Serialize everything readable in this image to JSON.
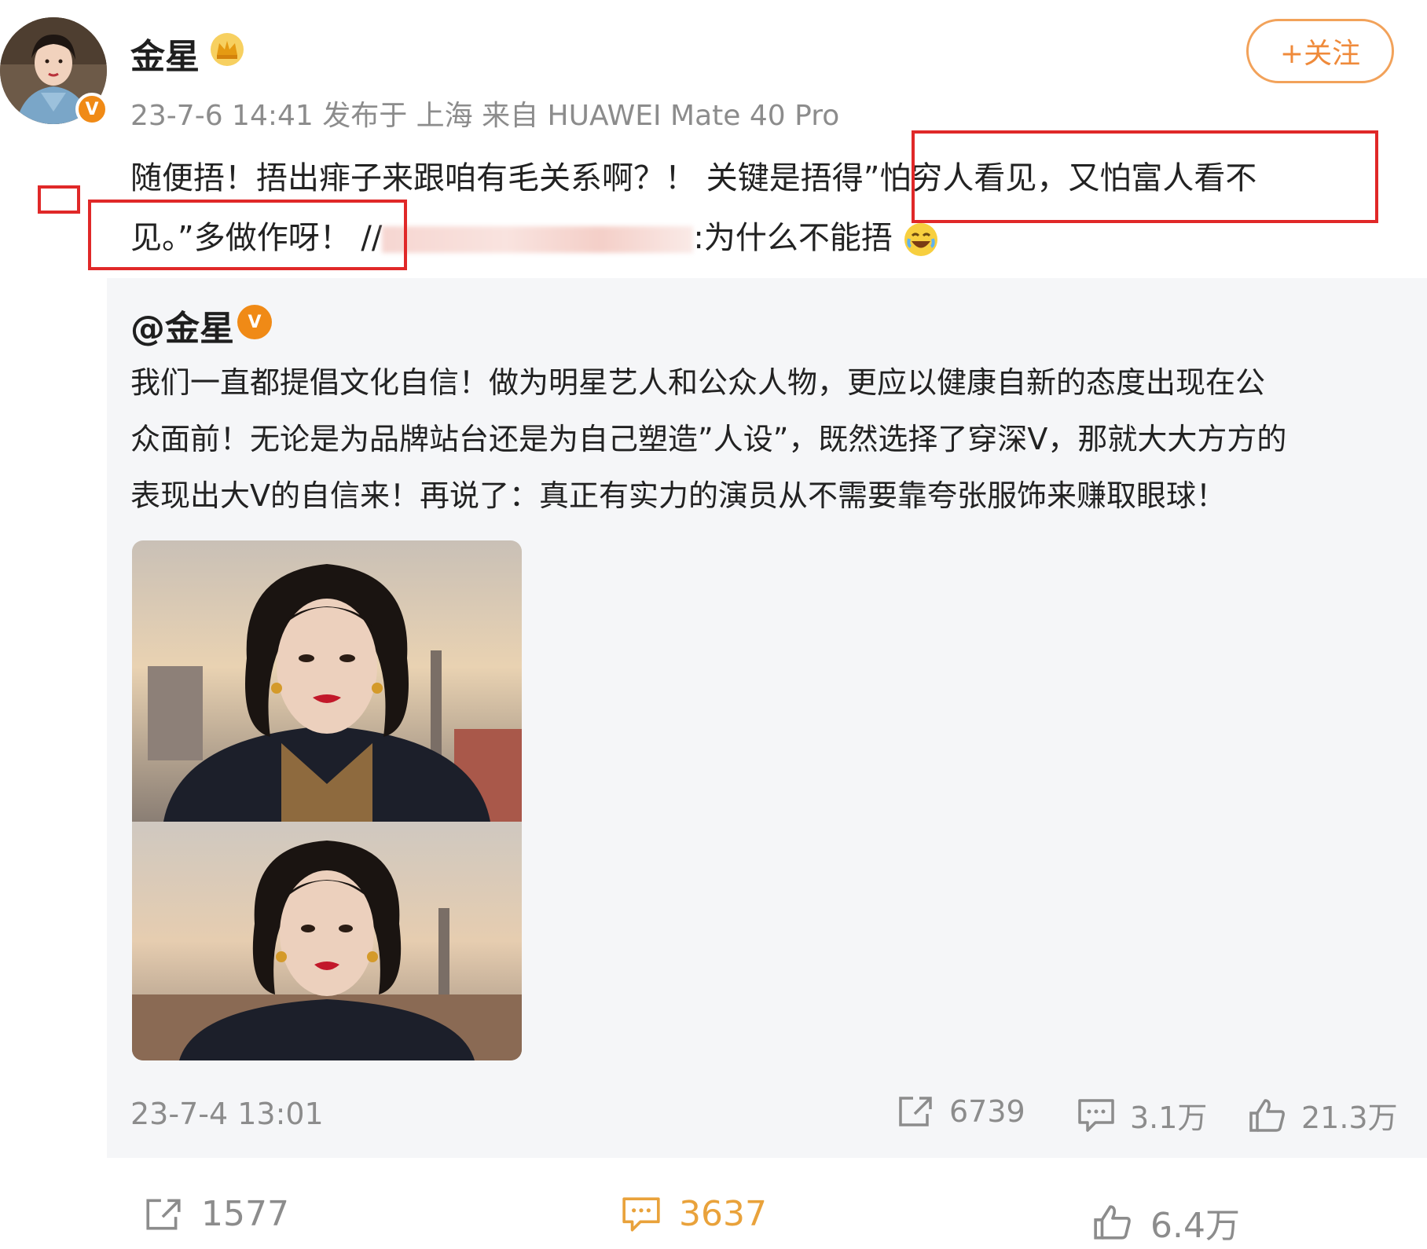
{
  "author": {
    "name": "金星",
    "verified_badge": "V",
    "meta": "23-7-6 14:41 发布于 上海 来自 HUAWEI Mate 40 Pro",
    "follow_label": "+关注"
  },
  "post": {
    "line1": "随便捂！捂出痱子来跟咱有毛关系啊？！ 关键是捂得”怕穷人看见，又怕富人看不",
    "line2_start": "见。”多做作呀！ //",
    "line2_end": ":为什么不能捂",
    "emoji": "laughing-emoji"
  },
  "repost": {
    "user": "@金星",
    "verified_badge": "V",
    "lines": [
      "我们一直都提倡文化自信！做为明星艺人和公众人物，更应以健康自新的态度出现在公",
      "众面前！无论是为品牌站台还是为自己塑造”人设”，既然选择了穿深V，那就大大方方的",
      "表现出大V的自信来！再说了：真正有实力的演员从不需要靠夸张服饰来赚取眼球！"
    ],
    "time": "23-7-4 13:01",
    "stats": {
      "share": "6739",
      "comment": "3.1万",
      "like": "21.3万"
    }
  },
  "footer": {
    "share": "1577",
    "comment": "3637",
    "like": "6.4万"
  },
  "colors": {
    "accent": "#ef8a3a",
    "highlight_box": "#e02828",
    "comment_active": "#e9a23b"
  }
}
